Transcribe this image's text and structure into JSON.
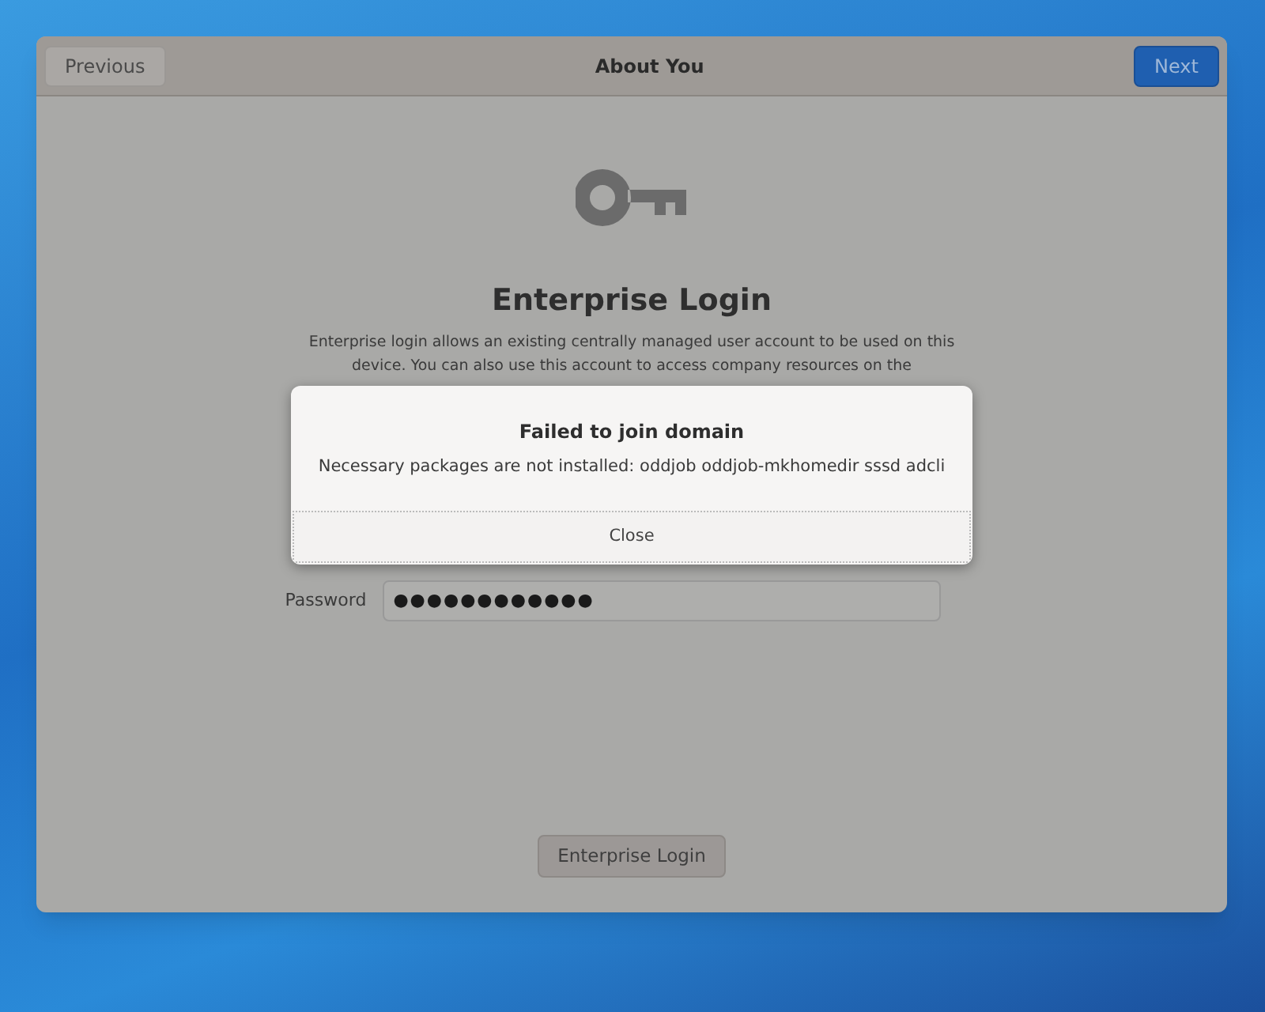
{
  "window": {
    "title": "About You",
    "previous_button": "Previous",
    "next_button": "Next"
  },
  "page": {
    "heading": "Enterprise Login",
    "description": "Enterprise login allows an existing centrally managed user account to be used on this device. You can also use this account to access company resources on the",
    "password_label": "Password",
    "password_value": "●●●●●●●●●●●●",
    "login_button": "Enterprise Login"
  },
  "dialog": {
    "title": "Failed to join domain",
    "message": "Necessary packages are not installed: oddjob oddjob-mkhomedir sssd adcli",
    "close_button": "Close"
  }
}
